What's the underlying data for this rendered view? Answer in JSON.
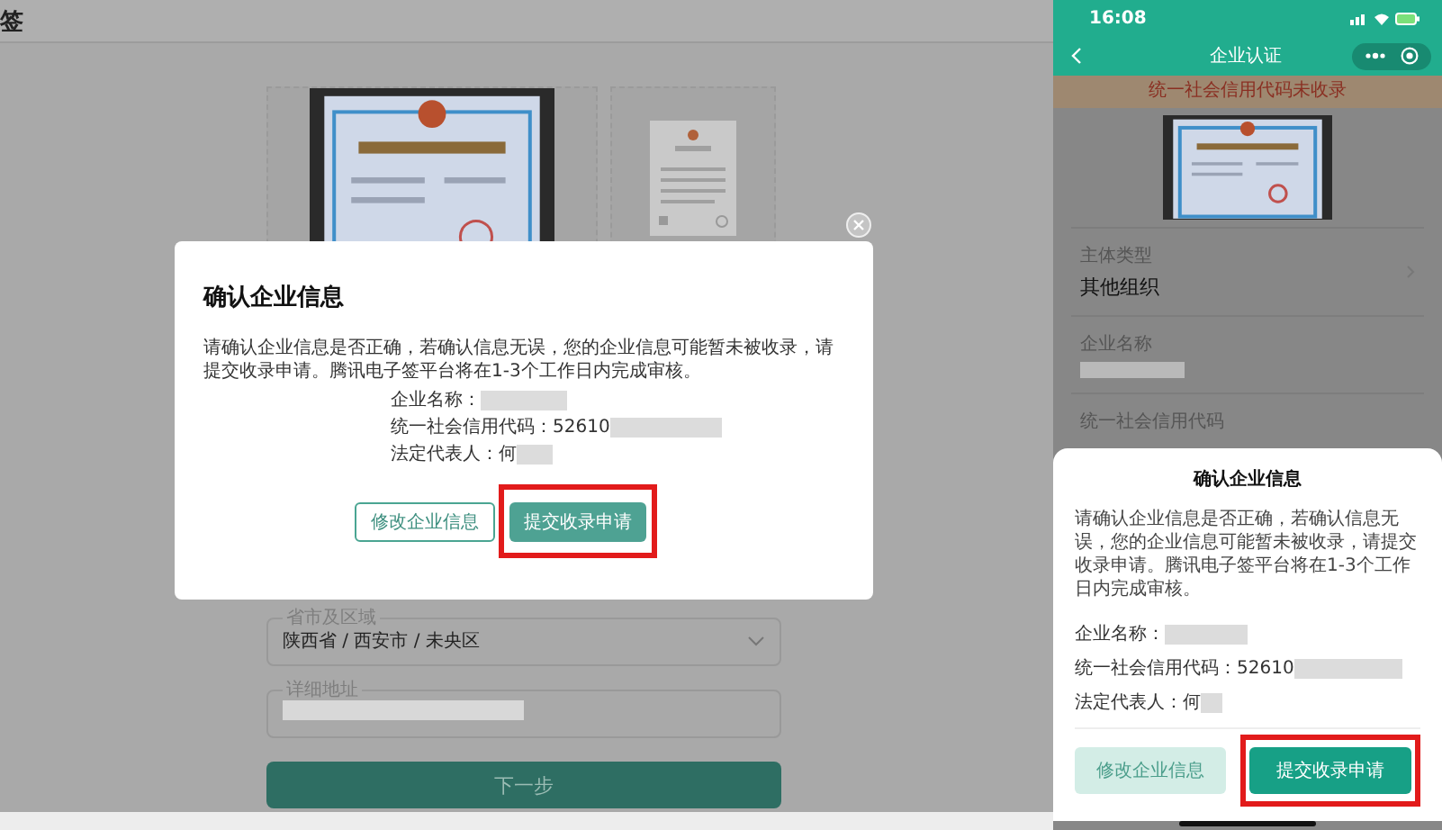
{
  "desktop": {
    "header_title": "签",
    "fields": [
      {
        "label": "省市及区域",
        "value": "陕西省 / 西安市 / 未央区",
        "kind": "select"
      },
      {
        "label": "详细地址",
        "kind": "redacted"
      }
    ],
    "next_button": "下一步",
    "dialog": {
      "title": "确认企业信息",
      "message": "请确认企业信息是否正确，若确认信息无误，您的企业信息可能暂未被收录，请提交收录申请。腾讯电子签平台将在1-3个工作日内完成审核。",
      "details": [
        {
          "label": "企业名称：",
          "redacted": true
        },
        {
          "label": "统一社会信用代码：",
          "value": "52610",
          "redacted": true
        },
        {
          "label": "法定代表人：",
          "value": "何",
          "redacted": true
        }
      ],
      "buttons": [
        {
          "label": "修改企业信息",
          "kind": "secondary",
          "highlighted": false
        },
        {
          "label": "提交收录申请",
          "kind": "primary",
          "highlighted": true
        }
      ]
    }
  },
  "mobile": {
    "status_time": "16:08",
    "nav_title": "企业认证",
    "banner": "统一社会信用代码未收录",
    "fields": [
      {
        "label": "主体类型",
        "value": "其他组织",
        "chevron": true
      },
      {
        "label": "企业名称",
        "redacted": true,
        "chevron": false
      },
      {
        "label": "统一社会信用代码",
        "chevron": false
      }
    ],
    "sheet": {
      "title": "确认企业信息",
      "message": "请确认企业信息是否正确，若确认信息无误，您的企业信息可能暂未被收录，请提交收录申请。腾讯电子签平台将在1-3个工作日内完成审核。",
      "details": [
        {
          "label": "企业名称：",
          "redacted": true
        },
        {
          "label": "统一社会信用代码：",
          "value": "52610",
          "redacted": true
        },
        {
          "label": "法定代表人：",
          "value": "何",
          "redacted": true
        }
      ],
      "buttons": [
        {
          "label": "修改企业信息",
          "kind": "secondary",
          "highlighted": false
        },
        {
          "label": "提交收录申请",
          "kind": "primary",
          "highlighted": true
        }
      ]
    }
  }
}
